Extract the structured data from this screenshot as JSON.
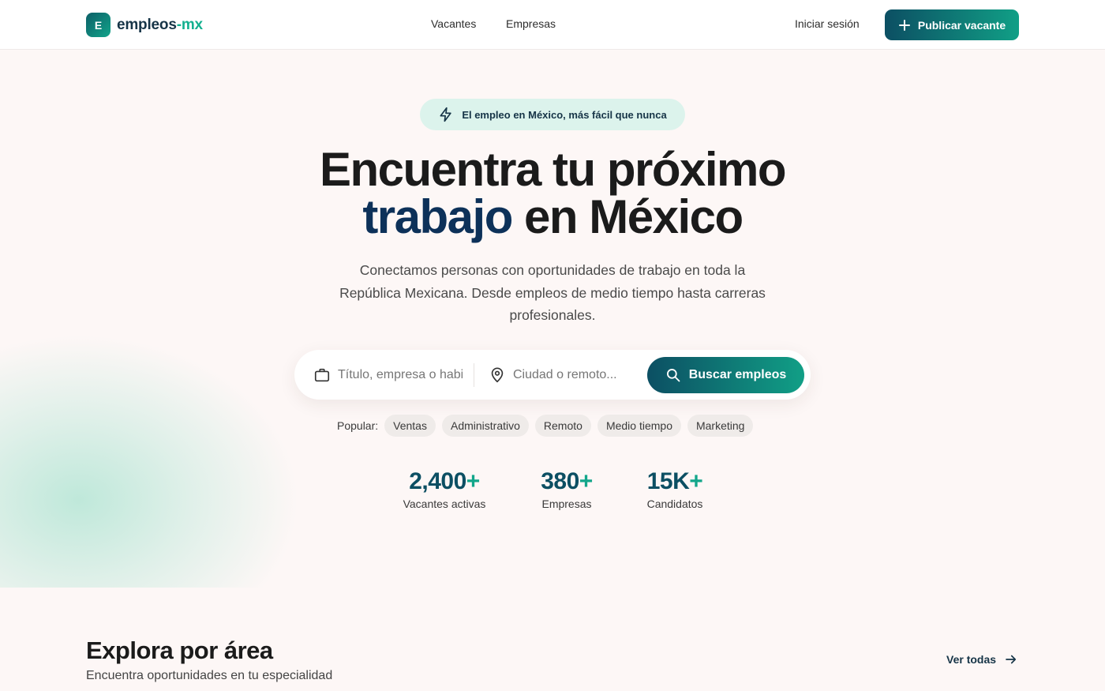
{
  "header": {
    "logo_letter": "E",
    "logo_name": "empleos",
    "logo_suffix": "-mx",
    "nav": [
      {
        "label": "Vacantes"
      },
      {
        "label": "Empresas"
      }
    ],
    "login_label": "Iniciar sesión",
    "publish_label": "Publicar vacante"
  },
  "hero": {
    "badge": "El empleo en México, más fácil que nunca",
    "headline_line1": "Encuentra tu próximo",
    "headline_highlight": "trabajo",
    "headline_line2_rest": " en México",
    "subtitle": "Conectamos personas con oportunidades de trabajo en toda la República Mexicana. Desde empleos de medio tiempo hasta carreras profesionales."
  },
  "search": {
    "job_placeholder": "Título, empresa o habilidad",
    "location_placeholder": "Ciudad o remoto...",
    "button_label": "Buscar empleos"
  },
  "popular": {
    "label": "Popular:",
    "tags": [
      "Ventas",
      "Administrativo",
      "Remoto",
      "Medio tiempo",
      "Marketing"
    ]
  },
  "stats": [
    {
      "value": "2,400",
      "suffix": "+",
      "label": "Vacantes activas"
    },
    {
      "value": "380",
      "suffix": "+",
      "label": "Empresas"
    },
    {
      "value": "15K",
      "suffix": "+",
      "label": "Candidatos"
    }
  ],
  "areas": {
    "title": "Explora por área",
    "subtitle": "Encuentra oportunidades en tu especialidad",
    "see_all": "Ver todas"
  },
  "colors": {
    "brand_dark": "#0c4f63",
    "brand_green": "#119f86",
    "headline_highlight": "#0d3159",
    "background": "#fdf7f6"
  },
  "icons": [
    "plus-icon",
    "lightning-icon",
    "briefcase-icon",
    "location-pin-icon",
    "search-icon",
    "arrow-right-icon"
  ]
}
